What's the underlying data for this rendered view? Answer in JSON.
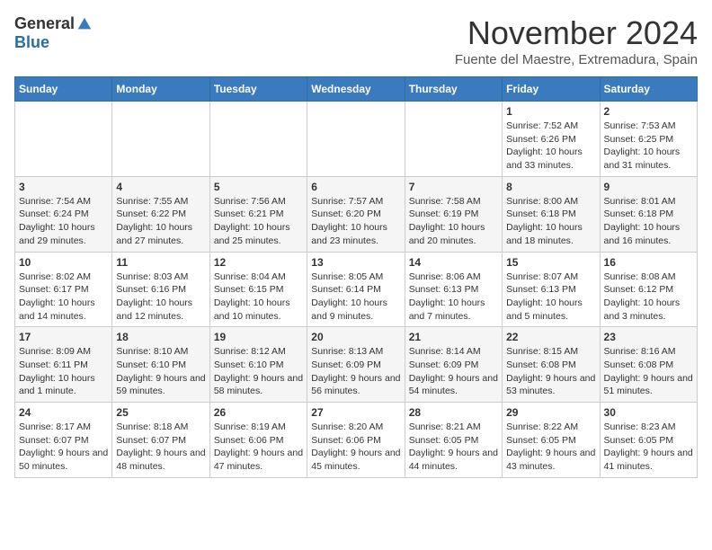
{
  "header": {
    "logo_general": "General",
    "logo_blue": "Blue",
    "month_title": "November 2024",
    "subtitle": "Fuente del Maestre, Extremadura, Spain"
  },
  "days_of_week": [
    "Sunday",
    "Monday",
    "Tuesday",
    "Wednesday",
    "Thursday",
    "Friday",
    "Saturday"
  ],
  "weeks": [
    [
      {
        "day": "",
        "info": ""
      },
      {
        "day": "",
        "info": ""
      },
      {
        "day": "",
        "info": ""
      },
      {
        "day": "",
        "info": ""
      },
      {
        "day": "",
        "info": ""
      },
      {
        "day": "1",
        "info": "Sunrise: 7:52 AM\nSunset: 6:26 PM\nDaylight: 10 hours and 33 minutes."
      },
      {
        "day": "2",
        "info": "Sunrise: 7:53 AM\nSunset: 6:25 PM\nDaylight: 10 hours and 31 minutes."
      }
    ],
    [
      {
        "day": "3",
        "info": "Sunrise: 7:54 AM\nSunset: 6:24 PM\nDaylight: 10 hours and 29 minutes."
      },
      {
        "day": "4",
        "info": "Sunrise: 7:55 AM\nSunset: 6:22 PM\nDaylight: 10 hours and 27 minutes."
      },
      {
        "day": "5",
        "info": "Sunrise: 7:56 AM\nSunset: 6:21 PM\nDaylight: 10 hours and 25 minutes."
      },
      {
        "day": "6",
        "info": "Sunrise: 7:57 AM\nSunset: 6:20 PM\nDaylight: 10 hours and 23 minutes."
      },
      {
        "day": "7",
        "info": "Sunrise: 7:58 AM\nSunset: 6:19 PM\nDaylight: 10 hours and 20 minutes."
      },
      {
        "day": "8",
        "info": "Sunrise: 8:00 AM\nSunset: 6:18 PM\nDaylight: 10 hours and 18 minutes."
      },
      {
        "day": "9",
        "info": "Sunrise: 8:01 AM\nSunset: 6:18 PM\nDaylight: 10 hours and 16 minutes."
      }
    ],
    [
      {
        "day": "10",
        "info": "Sunrise: 8:02 AM\nSunset: 6:17 PM\nDaylight: 10 hours and 14 minutes."
      },
      {
        "day": "11",
        "info": "Sunrise: 8:03 AM\nSunset: 6:16 PM\nDaylight: 10 hours and 12 minutes."
      },
      {
        "day": "12",
        "info": "Sunrise: 8:04 AM\nSunset: 6:15 PM\nDaylight: 10 hours and 10 minutes."
      },
      {
        "day": "13",
        "info": "Sunrise: 8:05 AM\nSunset: 6:14 PM\nDaylight: 10 hours and 9 minutes."
      },
      {
        "day": "14",
        "info": "Sunrise: 8:06 AM\nSunset: 6:13 PM\nDaylight: 10 hours and 7 minutes."
      },
      {
        "day": "15",
        "info": "Sunrise: 8:07 AM\nSunset: 6:13 PM\nDaylight: 10 hours and 5 minutes."
      },
      {
        "day": "16",
        "info": "Sunrise: 8:08 AM\nSunset: 6:12 PM\nDaylight: 10 hours and 3 minutes."
      }
    ],
    [
      {
        "day": "17",
        "info": "Sunrise: 8:09 AM\nSunset: 6:11 PM\nDaylight: 10 hours and 1 minute."
      },
      {
        "day": "18",
        "info": "Sunrise: 8:10 AM\nSunset: 6:10 PM\nDaylight: 9 hours and 59 minutes."
      },
      {
        "day": "19",
        "info": "Sunrise: 8:12 AM\nSunset: 6:10 PM\nDaylight: 9 hours and 58 minutes."
      },
      {
        "day": "20",
        "info": "Sunrise: 8:13 AM\nSunset: 6:09 PM\nDaylight: 9 hours and 56 minutes."
      },
      {
        "day": "21",
        "info": "Sunrise: 8:14 AM\nSunset: 6:09 PM\nDaylight: 9 hours and 54 minutes."
      },
      {
        "day": "22",
        "info": "Sunrise: 8:15 AM\nSunset: 6:08 PM\nDaylight: 9 hours and 53 minutes."
      },
      {
        "day": "23",
        "info": "Sunrise: 8:16 AM\nSunset: 6:08 PM\nDaylight: 9 hours and 51 minutes."
      }
    ],
    [
      {
        "day": "24",
        "info": "Sunrise: 8:17 AM\nSunset: 6:07 PM\nDaylight: 9 hours and 50 minutes."
      },
      {
        "day": "25",
        "info": "Sunrise: 8:18 AM\nSunset: 6:07 PM\nDaylight: 9 hours and 48 minutes."
      },
      {
        "day": "26",
        "info": "Sunrise: 8:19 AM\nSunset: 6:06 PM\nDaylight: 9 hours and 47 minutes."
      },
      {
        "day": "27",
        "info": "Sunrise: 8:20 AM\nSunset: 6:06 PM\nDaylight: 9 hours and 45 minutes."
      },
      {
        "day": "28",
        "info": "Sunrise: 8:21 AM\nSunset: 6:05 PM\nDaylight: 9 hours and 44 minutes."
      },
      {
        "day": "29",
        "info": "Sunrise: 8:22 AM\nSunset: 6:05 PM\nDaylight: 9 hours and 43 minutes."
      },
      {
        "day": "30",
        "info": "Sunrise: 8:23 AM\nSunset: 6:05 PM\nDaylight: 9 hours and 41 minutes."
      }
    ]
  ]
}
